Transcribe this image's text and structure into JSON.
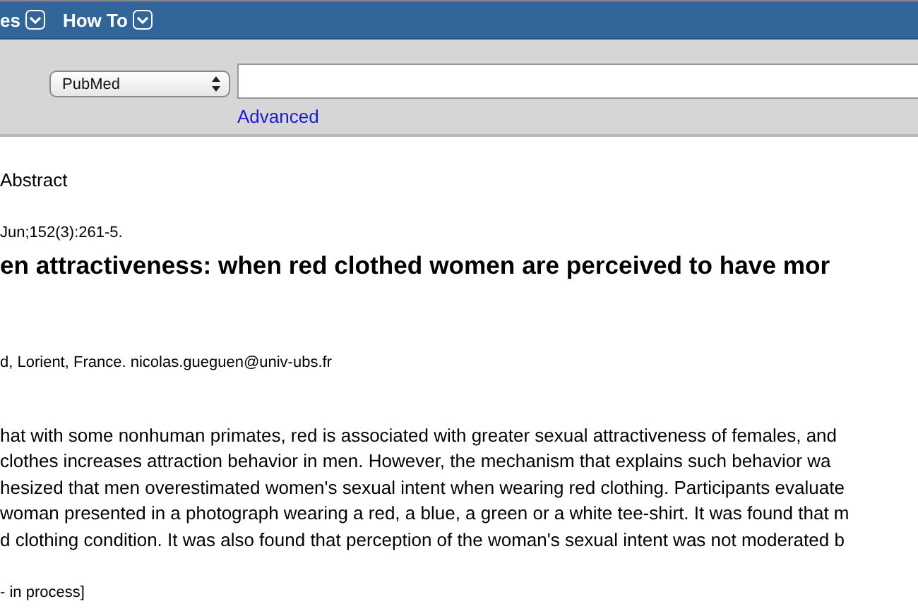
{
  "menu_bar": {
    "items": [
      {
        "label": "es"
      },
      {
        "label": "How To"
      }
    ]
  },
  "search": {
    "database": "PubMed",
    "advanced_link": "Advanced"
  },
  "format_label": "Abstract",
  "citation": "Jun;152(3):261-5.",
  "title": "en attractiveness: when red clothed women are perceived to have mor",
  "affiliation": "d, Lorient, France. nicolas.gueguen@univ-ubs.fr",
  "abstract_lines": [
    "hat with some nonhuman primates, red is associated with greater sexual attractiveness of females, and",
    "clothes increases attraction behavior in men. However, the mechanism that explains such behavior wa",
    "hesized that men overestimated women's sexual intent when wearing red clothing. Participants evaluate",
    "woman presented in a photograph wearing a red, a blue, a green or a white tee-shirt. It was found that m",
    "d clothing condition. It was also found that perception of the woman's sexual intent was not moderated b"
  ],
  "status_note": "- in process]"
}
